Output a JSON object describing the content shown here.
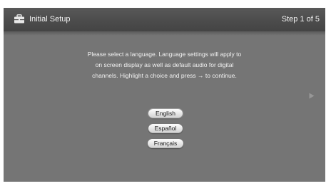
{
  "header": {
    "icon": "toolbox-icon",
    "title": "Initial Setup",
    "step": "Step 1 of 5"
  },
  "instructions": {
    "lines": [
      "Please select a language. Language settings will apply to",
      "on screen display as well as default audio for digital",
      "channels.  Highlight a choice and press → to continue."
    ]
  },
  "next_arrow": {
    "icon": "next-arrow-icon"
  },
  "languages": {
    "options": [
      {
        "label": "English",
        "selected": true
      },
      {
        "label": "Español",
        "selected": false
      },
      {
        "label": "Français",
        "selected": false
      }
    ]
  },
  "colors": {
    "background": "#757575",
    "titlebar": "#4c4c4c",
    "text": "#f2f2f2",
    "button_face": "#e6e6e6",
    "button_text": "#1a1a1a"
  }
}
